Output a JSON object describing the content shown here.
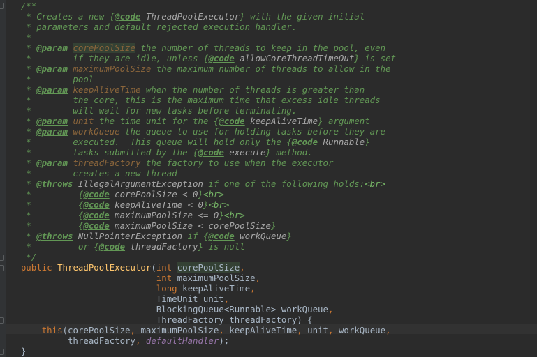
{
  "editor": {
    "language": "java",
    "colors": {
      "background": "#2b2b2b",
      "doc_comment": "#629755",
      "keyword": "#cc7832",
      "identifier": "#a9b7c6",
      "method_declaration": "#ffc66d",
      "field": "#9876aa",
      "param_name": "#8a653b"
    },
    "lines": [
      [
        {
          "t": "    /**",
          "c": "doc"
        }
      ],
      [
        {
          "t": "     * Creates a new ",
          "c": "doc"
        },
        {
          "t": "{",
          "c": "doc"
        },
        {
          "t": "@code",
          "c": "doctag"
        },
        {
          "t": " ThreadPoolExecutor",
          "c": "docref"
        },
        {
          "t": "}",
          "c": "doc"
        },
        {
          "t": " with the given initial",
          "c": "doc"
        }
      ],
      [
        {
          "t": "     * parameters and default rejected execution handler.",
          "c": "doc"
        }
      ],
      [
        {
          "t": "     *",
          "c": "doc"
        }
      ],
      [
        {
          "t": "     * ",
          "c": "doc"
        },
        {
          "t": "@param",
          "c": "doctag"
        },
        {
          "t": " ",
          "c": "doc"
        },
        {
          "t": "corePoolSize",
          "c": "param-hl"
        },
        {
          "t": " the number of threads to keep in the pool, even",
          "c": "doc"
        }
      ],
      [
        {
          "t": "     *        if they are idle, unless ",
          "c": "doc"
        },
        {
          "t": "{",
          "c": "doc"
        },
        {
          "t": "@code",
          "c": "doctag"
        },
        {
          "t": " allowCoreThreadTimeOut",
          "c": "docref"
        },
        {
          "t": "}",
          "c": "doc"
        },
        {
          "t": " is set",
          "c": "doc"
        }
      ],
      [
        {
          "t": "     * ",
          "c": "doc"
        },
        {
          "t": "@param",
          "c": "doctag"
        },
        {
          "t": " ",
          "c": "doc"
        },
        {
          "t": "maximumPoolSize",
          "c": "param"
        },
        {
          "t": " the maximum number of threads to allow in the",
          "c": "doc"
        }
      ],
      [
        {
          "t": "     *        pool",
          "c": "doc"
        }
      ],
      [
        {
          "t": "     * ",
          "c": "doc"
        },
        {
          "t": "@param",
          "c": "doctag"
        },
        {
          "t": " ",
          "c": "doc"
        },
        {
          "t": "keepAliveTime",
          "c": "param"
        },
        {
          "t": " when the number of threads is greater than",
          "c": "doc"
        }
      ],
      [
        {
          "t": "     *        the core, this is the maximum time that excess idle threads",
          "c": "doc"
        }
      ],
      [
        {
          "t": "     *        will wait for new tasks before terminating.",
          "c": "doc"
        }
      ],
      [
        {
          "t": "     * ",
          "c": "doc"
        },
        {
          "t": "@param",
          "c": "doctag"
        },
        {
          "t": " ",
          "c": "doc"
        },
        {
          "t": "unit",
          "c": "param"
        },
        {
          "t": " the time unit for the ",
          "c": "doc"
        },
        {
          "t": "{",
          "c": "doc"
        },
        {
          "t": "@code",
          "c": "doctag"
        },
        {
          "t": " keepAliveTime",
          "c": "docref"
        },
        {
          "t": "}",
          "c": "doc"
        },
        {
          "t": " argument",
          "c": "doc"
        }
      ],
      [
        {
          "t": "     * ",
          "c": "doc"
        },
        {
          "t": "@param",
          "c": "doctag"
        },
        {
          "t": " ",
          "c": "doc"
        },
        {
          "t": "workQueue",
          "c": "param"
        },
        {
          "t": " the queue to use for holding tasks before they are",
          "c": "doc"
        }
      ],
      [
        {
          "t": "     *        executed.  This queue will hold only the ",
          "c": "doc"
        },
        {
          "t": "{",
          "c": "doc"
        },
        {
          "t": "@code",
          "c": "doctag"
        },
        {
          "t": " Runnable",
          "c": "docref"
        },
        {
          "t": "}",
          "c": "doc"
        }
      ],
      [
        {
          "t": "     *        tasks submitted by the ",
          "c": "doc"
        },
        {
          "t": "{",
          "c": "doc"
        },
        {
          "t": "@code",
          "c": "doctag"
        },
        {
          "t": " execute",
          "c": "docref"
        },
        {
          "t": "}",
          "c": "doc"
        },
        {
          "t": " method.",
          "c": "doc"
        }
      ],
      [
        {
          "t": "     * ",
          "c": "doc"
        },
        {
          "t": "@param",
          "c": "doctag"
        },
        {
          "t": " ",
          "c": "doc"
        },
        {
          "t": "threadFactory",
          "c": "param"
        },
        {
          "t": " the factory to use when the executor",
          "c": "doc"
        }
      ],
      [
        {
          "t": "     *        creates a new thread",
          "c": "doc"
        }
      ],
      [
        {
          "t": "     * ",
          "c": "doc"
        },
        {
          "t": "@throws",
          "c": "doctag"
        },
        {
          "t": " ",
          "c": "doc"
        },
        {
          "t": "IllegalArgumentException",
          "c": "docref"
        },
        {
          "t": " if one of the following holds:",
          "c": "doc"
        },
        {
          "t": "<br>",
          "c": "html"
        }
      ],
      [
        {
          "t": "     *         ",
          "c": "doc"
        },
        {
          "t": "{",
          "c": "doc"
        },
        {
          "t": "@code",
          "c": "doctag"
        },
        {
          "t": " corePoolSize < 0",
          "c": "docref"
        },
        {
          "t": "}",
          "c": "doc"
        },
        {
          "t": "<br>",
          "c": "html"
        }
      ],
      [
        {
          "t": "     *         ",
          "c": "doc"
        },
        {
          "t": "{",
          "c": "doc"
        },
        {
          "t": "@code",
          "c": "doctag"
        },
        {
          "t": " keepAliveTime < 0",
          "c": "docref"
        },
        {
          "t": "}",
          "c": "doc"
        },
        {
          "t": "<br>",
          "c": "html"
        }
      ],
      [
        {
          "t": "     *         ",
          "c": "doc"
        },
        {
          "t": "{",
          "c": "doc"
        },
        {
          "t": "@code",
          "c": "doctag"
        },
        {
          "t": " maximumPoolSize <= 0",
          "c": "docref"
        },
        {
          "t": "}",
          "c": "doc"
        },
        {
          "t": "<br>",
          "c": "html"
        }
      ],
      [
        {
          "t": "     *         ",
          "c": "doc"
        },
        {
          "t": "{",
          "c": "doc"
        },
        {
          "t": "@code",
          "c": "doctag"
        },
        {
          "t": " maximumPoolSize < corePoolSize",
          "c": "docref"
        },
        {
          "t": "}",
          "c": "doc"
        }
      ],
      [
        {
          "t": "     * ",
          "c": "doc"
        },
        {
          "t": "@throws",
          "c": "doctag"
        },
        {
          "t": " ",
          "c": "doc"
        },
        {
          "t": "NullPointerException",
          "c": "docref"
        },
        {
          "t": " if ",
          "c": "doc"
        },
        {
          "t": "{",
          "c": "doc"
        },
        {
          "t": "@code",
          "c": "doctag"
        },
        {
          "t": " workQueue",
          "c": "docref"
        },
        {
          "t": "}",
          "c": "doc"
        }
      ],
      [
        {
          "t": "     *         or ",
          "c": "doc"
        },
        {
          "t": "{",
          "c": "doc"
        },
        {
          "t": "@code",
          "c": "doctag"
        },
        {
          "t": " threadFactory",
          "c": "docref"
        },
        {
          "t": "}",
          "c": "doc"
        },
        {
          "t": " is null",
          "c": "doc"
        }
      ],
      [
        {
          "t": "     */",
          "c": "doc"
        }
      ],
      [
        {
          "t": "    ",
          "c": "plain"
        },
        {
          "t": "public ",
          "c": "kw"
        },
        {
          "t": "ThreadPoolExecutor",
          "c": "method"
        },
        {
          "t": "(",
          "c": "plain"
        },
        {
          "t": "int ",
          "c": "kw"
        },
        {
          "t": "corePoolSize",
          "c": "plain-hl"
        },
        {
          "t": ",",
          "c": "kw"
        }
      ],
      [
        {
          "t": "                              ",
          "c": "plain"
        },
        {
          "t": "int ",
          "c": "kw"
        },
        {
          "t": "maximumPoolSize",
          "c": "plain"
        },
        {
          "t": ",",
          "c": "kw"
        }
      ],
      [
        {
          "t": "                              ",
          "c": "plain"
        },
        {
          "t": "long ",
          "c": "kw"
        },
        {
          "t": "keepAliveTime",
          "c": "plain"
        },
        {
          "t": ",",
          "c": "kw"
        }
      ],
      [
        {
          "t": "                              TimeUnit unit",
          "c": "plain"
        },
        {
          "t": ",",
          "c": "kw"
        }
      ],
      [
        {
          "t": "                              BlockingQueue<Runnable> workQueue",
          "c": "plain"
        },
        {
          "t": ",",
          "c": "kw"
        }
      ],
      [
        {
          "t": "                              ThreadFactory threadFactory) {",
          "c": "plain"
        }
      ],
      [
        {
          "t": "        ",
          "c": "plain"
        },
        {
          "t": "this",
          "c": "kw"
        },
        {
          "t": "(corePoolSize",
          "c": "plain"
        },
        {
          "t": ", ",
          "c": "kw"
        },
        {
          "t": "maximumPoolSize",
          "c": "plain"
        },
        {
          "t": ", ",
          "c": "kw"
        },
        {
          "t": "keepAliveTime",
          "c": "plain"
        },
        {
          "t": ", ",
          "c": "kw"
        },
        {
          "t": "unit",
          "c": "plain"
        },
        {
          "t": ", ",
          "c": "kw"
        },
        {
          "t": "workQueue",
          "c": "plain"
        },
        {
          "t": ",",
          "c": "kw"
        }
      ],
      [
        {
          "t": "             threadFactory",
          "c": "plain"
        },
        {
          "t": ", ",
          "c": "kw"
        },
        {
          "t": "defaultHandler",
          "c": "field"
        },
        {
          "t": ");",
          "c": "plain"
        }
      ],
      [
        {
          "t": "    }",
          "c": "plain"
        }
      ]
    ]
  }
}
